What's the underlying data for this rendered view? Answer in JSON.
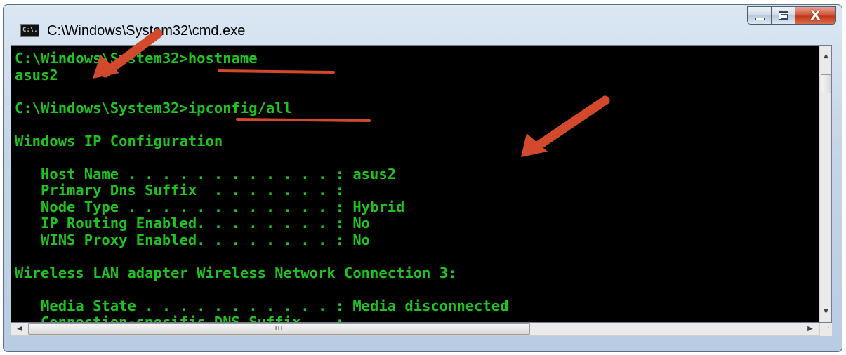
{
  "window": {
    "title": "C:\\Windows\\System32\\cmd.exe",
    "icon": "cmd-icon",
    "icon_text": "C:\\.",
    "controls": {
      "minimize": "minimize-icon",
      "maximize": "maximize-icon",
      "close": "close-icon",
      "close_glyph": "X"
    }
  },
  "console": {
    "lines": [
      "C:\\Windows\\System32>hostname",
      "asus2",
      "",
      "C:\\Windows\\System32>ipconfig/all",
      "",
      "Windows IP Configuration",
      "",
      "   Host Name . . . . . . . . . . . . : asus2",
      "   Primary Dns Suffix  . . . . . . . :",
      "   Node Type . . . . . . . . . . . . : Hybrid",
      "   IP Routing Enabled. . . . . . . . : No",
      "   WINS Proxy Enabled. . . . . . . . : No",
      "",
      "Wireless LAN adapter Wireless Network Connection 3:",
      "",
      "   Media State . . . . . . . . . . . : Media disconnected",
      "   Connection-specific DNS Suffix  . :"
    ],
    "text_color": "#1fc31f",
    "background": "#000000"
  },
  "scrollbars": {
    "vertical": {
      "up": "up-arrow-icon",
      "down": "down-arrow-icon",
      "up_glyph": "▲",
      "down_glyph": "▼"
    },
    "horizontal": {
      "left": "left-arrow-icon",
      "right": "right-arrow-icon",
      "left_glyph": "◀",
      "right_glyph": "▶",
      "thumb_grip": "III"
    },
    "resize_grip": ".::"
  },
  "annotations": {
    "color": "#d2492c"
  }
}
